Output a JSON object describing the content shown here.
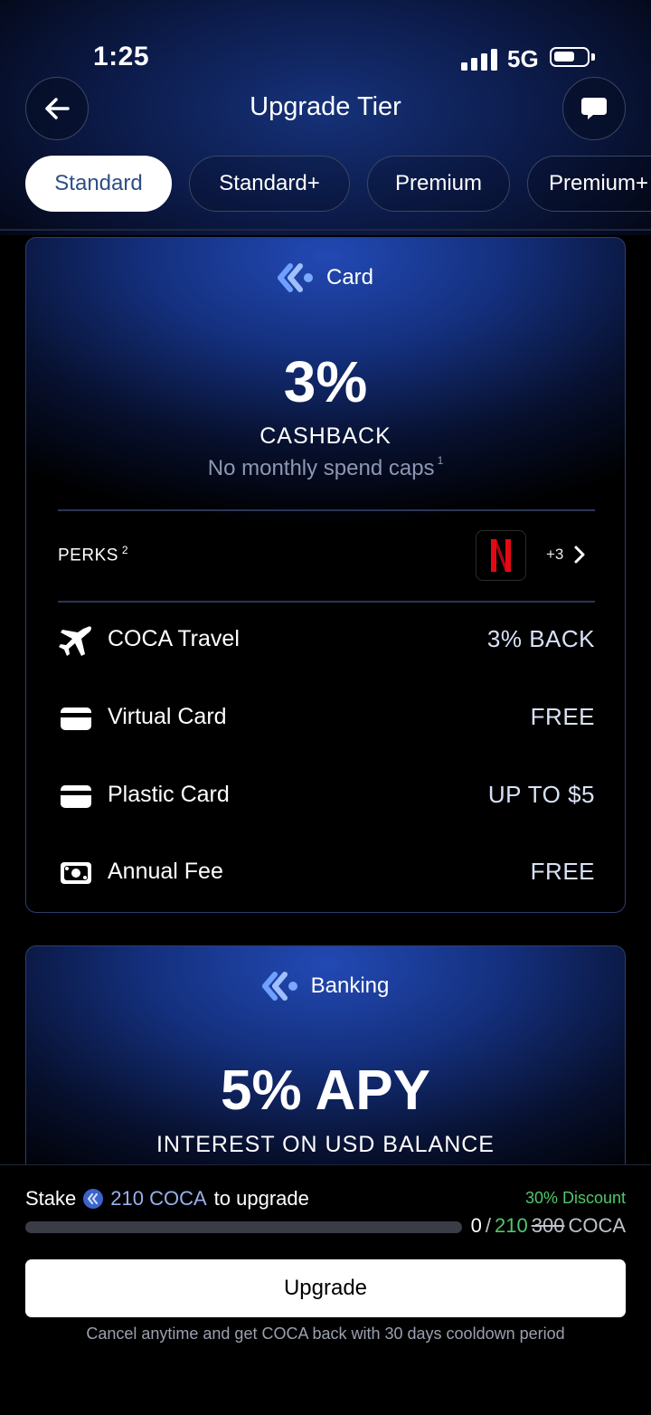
{
  "status_bar": {
    "time": "1:25",
    "network": "5G"
  },
  "header": {
    "title": "Upgrade Tier"
  },
  "tabs": [
    {
      "label": "Standard",
      "active": true
    },
    {
      "label": "Standard+",
      "active": false
    },
    {
      "label": "Premium",
      "active": false
    },
    {
      "label": "Premium+",
      "active": false
    }
  ],
  "card_section": {
    "heading": "Card",
    "headline": "3%",
    "subheading": "CASHBACK",
    "note": "No monthly spend caps",
    "note_ref": "1",
    "perks_label": "PERKS",
    "perks_ref": "2",
    "perks_more": "+3",
    "features": [
      {
        "icon": "airplane-icon",
        "label": "COCA Travel",
        "value": "3% BACK"
      },
      {
        "icon": "credit-card-icon",
        "label": "Virtual Card",
        "value": "FREE"
      },
      {
        "icon": "credit-card-icon",
        "label": "Plastic Card",
        "value": "UP TO $5"
      },
      {
        "icon": "cash-icon",
        "label": "Annual Fee",
        "value": "FREE"
      }
    ]
  },
  "banking_section": {
    "heading": "Banking",
    "headline": "5% APY",
    "subheading": "INTEREST ON USD BALANCE"
  },
  "stake": {
    "prefix": "Stake",
    "amount": "210 COCA",
    "suffix": "to upgrade",
    "discount": "30% Discount",
    "current": "0",
    "target": "210",
    "original": "300",
    "unit": "COCA",
    "progress_fraction": 0
  },
  "upgrade_button": "Upgrade",
  "footnote": "Cancel anytime and get COCA back with 30 days cooldown period",
  "colors": {
    "accent_green": "#51c76a",
    "active_tab_text": "#2d4e86",
    "card_blue": "#2249b4"
  }
}
